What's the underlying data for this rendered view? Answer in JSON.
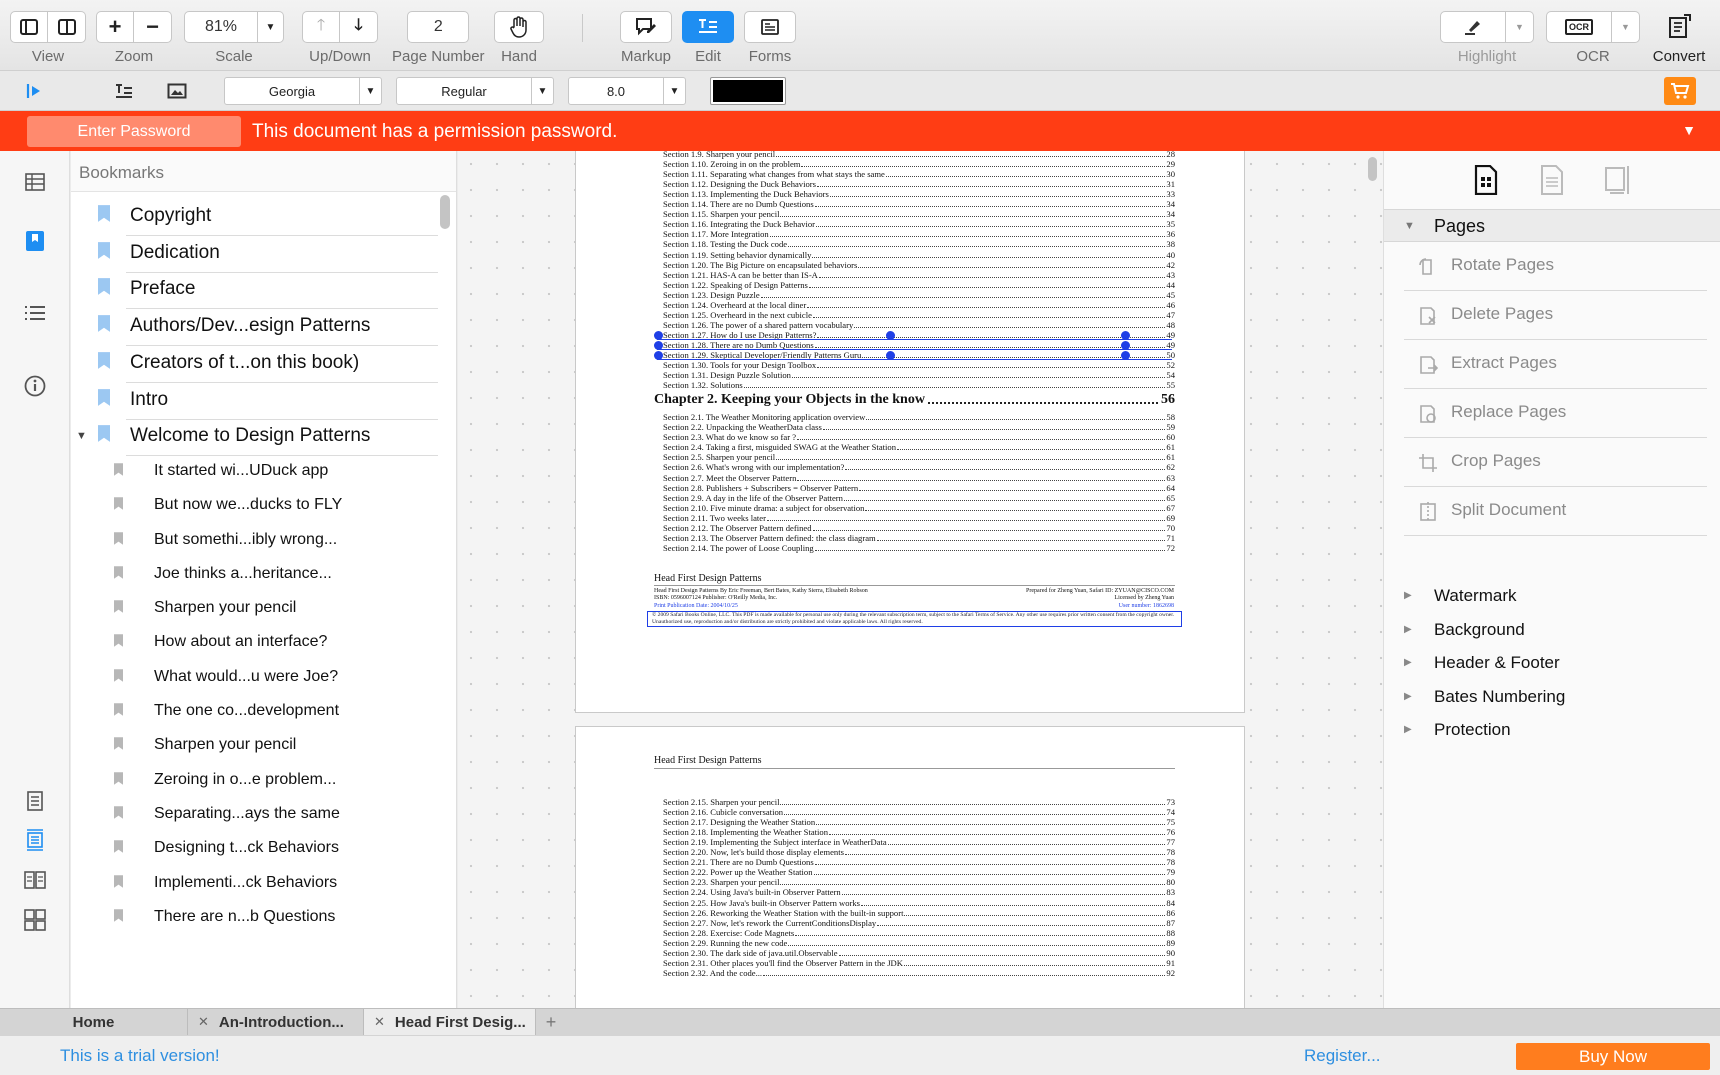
{
  "toolbar": {
    "view_label": "View",
    "zoom_label": "Zoom",
    "scale_value": "81%",
    "scale_label": "Scale",
    "updown_label": "Up/Down",
    "page_number_value": "2",
    "page_number_label": "Page Number",
    "hand_label": "Hand",
    "markup_label": "Markup",
    "edit_label": "Edit",
    "forms_label": "Forms",
    "highlight_label": "Highlight",
    "ocr_label": "OCR",
    "ocr_icon_text": "OCR",
    "convert_label": "Convert",
    "accent": "#1e8ef2"
  },
  "format_bar": {
    "font_family": "Georgia",
    "font_style": "Regular",
    "font_size": "8.0",
    "text_color": "#000000",
    "cart_color": "#ff8a14"
  },
  "banner": {
    "button_label": "Enter Password",
    "message": "This document has a permission password.",
    "color": "#ff3d14"
  },
  "bookmarks": {
    "title": "Bookmarks",
    "items": [
      {
        "label": "Copyright"
      },
      {
        "label": "Dedication"
      },
      {
        "label": "Preface"
      },
      {
        "label": "Authors/Dev...esign Patterns"
      },
      {
        "label": "Creators of t...on this book)"
      },
      {
        "label": "Intro"
      },
      {
        "label": "Welcome to Design Patterns"
      }
    ],
    "children": [
      {
        "label": "It started wi...UDuck app"
      },
      {
        "label": "But now we...ducks to FLY"
      },
      {
        "label": "But somethi...ibly wrong..."
      },
      {
        "label": "Joe thinks a...heritance..."
      },
      {
        "label": "Sharpen your pencil"
      },
      {
        "label": "How about an interface?"
      },
      {
        "label": "What would...u were Joe?"
      },
      {
        "label": "The one co...development"
      },
      {
        "label": "Sharpen your pencil"
      },
      {
        "label": "Zeroing in o...e problem..."
      },
      {
        "label": "Separating...ays the same"
      },
      {
        "label": "Designing t...ck Behaviors"
      },
      {
        "label": "Implementi...ck Behaviors"
      },
      {
        "label": "There are n...b Questions"
      }
    ]
  },
  "document": {
    "page1_toc": [
      {
        "t": "Section 1.9. Sharpen your pencil",
        "p": "28"
      },
      {
        "t": "Section 1.10. Zeroing in on the problem",
        "p": "29"
      },
      {
        "t": "Section 1.11. Separating what changes from what stays the same",
        "p": "30"
      },
      {
        "t": "Section 1.12. Designing the Duck Behaviors",
        "p": "31"
      },
      {
        "t": "Section 1.13. Implementing the Duck Behaviors",
        "p": "33"
      },
      {
        "t": "Section 1.14. There are no Dumb Questions",
        "p": "34"
      },
      {
        "t": "Section 1.15. Sharpen your pencil",
        "p": "34"
      },
      {
        "t": "Section 1.16. Integrating the Duck Behavior",
        "p": "35"
      },
      {
        "t": "Section 1.17. More Integration",
        "p": "36"
      },
      {
        "t": "Section 1.18. Testing the Duck code",
        "p": "38"
      },
      {
        "t": "Section 1.19. Setting behavior dynamically",
        "p": "40"
      },
      {
        "t": "Section 1.20. The Big Picture on encapsulated behaviors",
        "p": "42"
      },
      {
        "t": "Section 1.21. HAS-A can be better than IS-A",
        "p": "43"
      },
      {
        "t": "Section 1.22. Speaking of Design Patterns",
        "p": "44"
      },
      {
        "t": "Section 1.23. Design Puzzle",
        "p": "45"
      },
      {
        "t": "Section 1.24. Overheard at the local diner",
        "p": "46"
      },
      {
        "t": "Section 1.25. Overheard in the next cubicle",
        "p": "47"
      },
      {
        "t": "Section 1.26. The power of a shared pattern vocabulary",
        "p": "48"
      },
      {
        "t": "Section 1.27. How do I use Design Patterns?",
        "p": "49"
      },
      {
        "t": "Section 1.28. There are no Dumb Questions",
        "p": "49"
      },
      {
        "t": "Section 1.29. Skeptical Developer/Friendly Patterns Guru",
        "p": "50"
      },
      {
        "t": "Section 1.30. Tools for your Design Toolbox",
        "p": "52"
      },
      {
        "t": "Section 1.31. Design Puzzle Solution",
        "p": "54"
      },
      {
        "t": "Section 1.32. Solutions",
        "p": "55"
      }
    ],
    "chapter2": {
      "t": "Chapter 2. Keeping your Objects in the know",
      "p": "56"
    },
    "page1_toc2": [
      {
        "t": "Section 2.1. The Weather Monitoring application overview",
        "p": "58"
      },
      {
        "t": "Section 2.2. Unpacking the WeatherData class",
        "p": "59"
      },
      {
        "t": "Section 2.3. What do we know so far ?",
        "p": "60"
      },
      {
        "t": "Section 2.4. Taking a first, misguided SWAG at the Weather Station",
        "p": "61"
      },
      {
        "t": "Section 2.5. Sharpen your pencil",
        "p": "61"
      },
      {
        "t": "Section 2.6. What's wrong with our implementation?",
        "p": "62"
      },
      {
        "t": "Section 2.7. Meet the Observer Pattern",
        "p": "63"
      },
      {
        "t": "Section 2.8. Publishers + Subscribers = Observer Pattern",
        "p": "64"
      },
      {
        "t": "Section 2.9. A day in the life of the Observer Pattern",
        "p": "65"
      },
      {
        "t": "Section 2.10. Five minute drama: a subject for observation",
        "p": "67"
      },
      {
        "t": "Section 2.11. Two weeks later",
        "p": "69"
      },
      {
        "t": "Section 2.12. The Observer Pattern defined",
        "p": "70"
      },
      {
        "t": "Section 2.13. The Observer Pattern defined: the class diagram",
        "p": "71"
      },
      {
        "t": "Section 2.14. The power of Loose Coupling",
        "p": "72"
      }
    ],
    "footer_title": "Head First Design Patterns",
    "footer_line1_left": "Head First Design Patterns By Eric Freeman, Bert Bates, Kathy Sierra, Elisabeth Robson",
    "footer_line1_right": "Prepared for Zheng Yuan, Safari ID: ZYUAN@CISCO.COM",
    "footer_line2_left": "ISBN: 0596007124 Publisher: O'Reilly Media, Inc.",
    "footer_line2_right": "Licensed by Zheng Yuan",
    "footer_line3_left": "Print Publication Date: 2004/10/25",
    "footer_line3_right": "User number: 1862698",
    "footer_legal": "© 2009 Safari Books Online, LLC. This PDF is made available for personal use only during the relevant subscription term, subject to the Safari Terms of Service. Any other use requires prior written consent from the copyright owner. Unauthorized use, reproduction and/or distribution are strictly prohibited and violate applicable laws. All rights reserved.",
    "page2_header": "Head First Design Patterns",
    "page2_toc": [
      {
        "t": "Section 2.15. Sharpen your pencil",
        "p": "73"
      },
      {
        "t": "Section 2.16. Cubicle conversation",
        "p": "74"
      },
      {
        "t": "Section 2.17. Designing the Weather Station",
        "p": "75"
      },
      {
        "t": "Section 2.18. Implementing the Weather Station",
        "p": "76"
      },
      {
        "t": "Section 2.19. Implementing the Subject interface in WeatherData",
        "p": "77"
      },
      {
        "t": "Section 2.20. Now, let's build those display elements",
        "p": "78"
      },
      {
        "t": "Section 2.21. There are no Dumb Questions",
        "p": "78"
      },
      {
        "t": "Section 2.22. Power up the Weather Station",
        "p": "79"
      },
      {
        "t": "Section 2.23. Sharpen your pencil",
        "p": "80"
      },
      {
        "t": "Section 2.24. Using Java's built-in Observer Pattern",
        "p": "83"
      },
      {
        "t": "Section 2.25. How Java's built-in Observer Pattern works",
        "p": "84"
      },
      {
        "t": "Section 2.26. Reworking the Weather Station with the built-in support",
        "p": "86"
      },
      {
        "t": "Section 2.27. Now, let's rework the CurrentConditionsDisplay",
        "p": "87"
      },
      {
        "t": "Section 2.28. Exercise: Code Magnets",
        "p": "88"
      },
      {
        "t": "Section 2.29. Running the new code",
        "p": "89"
      },
      {
        "t": "Section 2.30. The dark side of java.util.Observable",
        "p": "90"
      },
      {
        "t": "Section 2.31. Other places you'll find the Observer Pattern in the JDK",
        "p": "91"
      },
      {
        "t": "Section 2.32. And the code...",
        "p": "92"
      }
    ],
    "selection_color": "#1f3fe6"
  },
  "right_panel": {
    "pages_label": "Pages",
    "actions": [
      {
        "label": "Rotate Pages",
        "icon": "rotate-icon"
      },
      {
        "label": "Delete Pages",
        "icon": "delete-page-icon"
      },
      {
        "label": "Extract Pages",
        "icon": "extract-page-icon"
      },
      {
        "label": "Replace Pages",
        "icon": "replace-page-icon"
      },
      {
        "label": "Crop Pages",
        "icon": "crop-icon"
      },
      {
        "label": "Split Document",
        "icon": "split-icon"
      }
    ],
    "sections": [
      {
        "label": "Watermark"
      },
      {
        "label": "Background"
      },
      {
        "label": "Header & Footer"
      },
      {
        "label": "Bates Numbering"
      },
      {
        "label": "Protection"
      }
    ]
  },
  "tabs": [
    {
      "label": "Home"
    },
    {
      "label": "An-Introduction..."
    },
    {
      "label": "Head First Desig..."
    }
  ],
  "status": {
    "trial": "This is a trial version!",
    "register": "Register...",
    "buy_now": "Buy Now",
    "link_color": "#2e8fe0",
    "buy_color": "#ff7d1e"
  }
}
